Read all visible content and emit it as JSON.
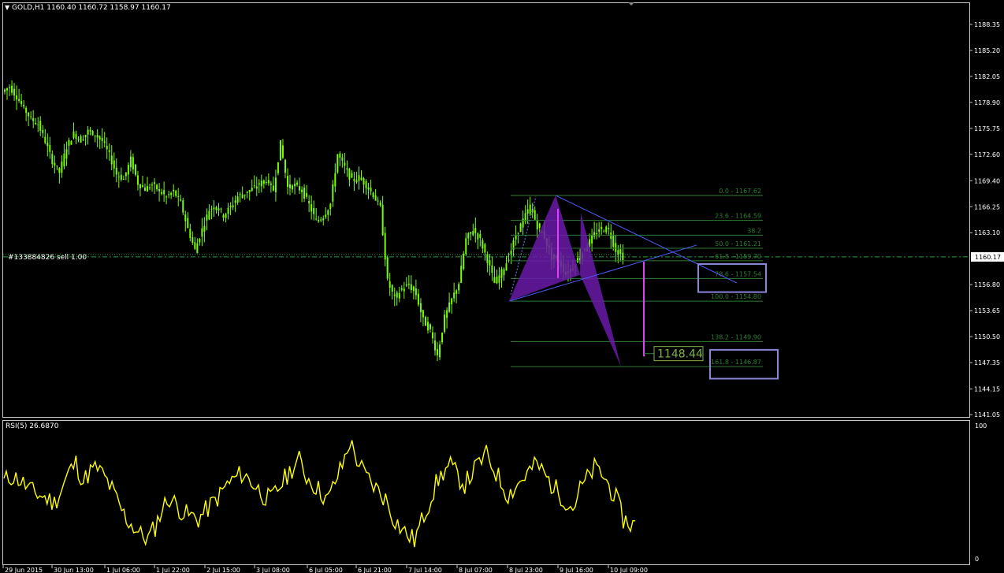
{
  "main_title": "GOLD,H1  1160.40 1160.72 1158.97 1160.17",
  "rsi_title": "RSI(5) 26.6870",
  "order_label": "#133884826 sell 1.00",
  "current_price": "1160.17",
  "target_label": "1148.44",
  "colors": {
    "background": "#000000",
    "candle": "#7cfc00",
    "rsi": "#ffff00",
    "pattern": "#6a1aa8",
    "trendline": "#4a5cff",
    "fib": "#2e7d32",
    "box": "#8a86d8",
    "projection": "#e040fb"
  },
  "chart_data": [
    {
      "type": "candlestick",
      "ylim": [
        1141.0,
        1189.5
      ],
      "price_ticks": [
        "1188.35",
        "1185.20",
        "1182.05",
        "1178.90",
        "1175.75",
        "1172.60",
        "1169.40",
        "1166.25",
        "1163.10",
        "1160.17",
        "1156.80",
        "1153.65",
        "1150.50",
        "1147.35",
        "1144.15",
        "1141.05"
      ],
      "date_ticks": [
        "29 Jun 2015",
        "30 Jun 13:00",
        "1 Jul 06:00",
        "1 Jul 22:00",
        "2 Jul 15:00",
        "3 Jul 08:00",
        "6 Jul 05:00",
        "6 Jul 21:00",
        "7 Jul 14:00",
        "8 Jul 07:00",
        "8 Jul 23:00",
        "9 Jul 16:00",
        "10 Jul 09:00"
      ],
      "close_path": [
        1180.2,
        1180.8,
        1179.6,
        1178.2,
        1176.9,
        1176.3,
        1174.2,
        1171.8,
        1170.4,
        1173.5,
        1175.1,
        1174.3,
        1175.4,
        1175.0,
        1174.2,
        1172.5,
        1170.2,
        1169.6,
        1172.0,
        1169.1,
        1168.4,
        1168.9,
        1168.2,
        1167.4,
        1168.1,
        1166.7,
        1163.6,
        1161.0,
        1163.5,
        1165.9,
        1166.4,
        1165.2,
        1166.2,
        1167.5,
        1167.9,
        1168.4,
        1169.0,
        1169.5,
        1168.3,
        1173.9,
        1168.6,
        1168.8,
        1168.2,
        1166.5,
        1164.5,
        1165.1,
        1166.6,
        1172.6,
        1171.0,
        1169.4,
        1169.8,
        1168.9,
        1167.7,
        1166.1,
        1157.2,
        1155.1,
        1156.3,
        1156.8,
        1155.6,
        1152.5,
        1151.2,
        1148.2,
        1152.8,
        1155.0,
        1157.0,
        1162.3,
        1163.5,
        1162.2,
        1159.8,
        1157.0,
        1158.3,
        1160.1,
        1162.8,
        1164.6,
        1166.3,
        1163.9,
        1162.6,
        1160.1,
        1159.7,
        1158.1,
        1159.0,
        1160.3,
        1161.6,
        1162.9,
        1163.6,
        1163.4,
        1161.0,
        1160.17
      ],
      "fib_levels": [
        {
          "label": "0.0 - 1167.62",
          "price": 1167.62
        },
        {
          "label": "23.6 - 1164.59",
          "price": 1164.59
        },
        {
          "label": "38.2",
          "price": 1162.8
        },
        {
          "label": "50.0 - 1161.21",
          "price": 1161.21
        },
        {
          "label": "61.8 - 1159.70",
          "price": 1159.7
        },
        {
          "label": "78.6 - 1157.54",
          "price": 1157.54
        },
        {
          "label": "100.0 - 1154.80",
          "price": 1154.8
        },
        {
          "label": "138.2 - 1149.90",
          "price": 1149.9
        },
        {
          "label": "161.8 - 1146.87",
          "price": 1146.87
        }
      ]
    },
    {
      "type": "line",
      "ylim": [
        0,
        100
      ],
      "y_ticks": [
        "100",
        "0"
      ],
      "series": [
        {
          "values": [
            58,
            62,
            60,
            55,
            50,
            48,
            45,
            42,
            52,
            65,
            72,
            58,
            66,
            68,
            61,
            52,
            40,
            30,
            24,
            18,
            15,
            24,
            38,
            46,
            40,
            34,
            32,
            30,
            36,
            42,
            48,
            56,
            60,
            64,
            60,
            54,
            48,
            44,
            52,
            60,
            68,
            74,
            62,
            56,
            50,
            44,
            58,
            70,
            88,
            75,
            64,
            57,
            51,
            45,
            32,
            24,
            18,
            14,
            28,
            42,
            56,
            65,
            70,
            62,
            56,
            64,
            72,
            78,
            68,
            58,
            48,
            54,
            60,
            66,
            71,
            64,
            56,
            50,
            44,
            38,
            52,
            60,
            68,
            64,
            55,
            45,
            30,
            26
          ]
        }
      ]
    }
  ]
}
